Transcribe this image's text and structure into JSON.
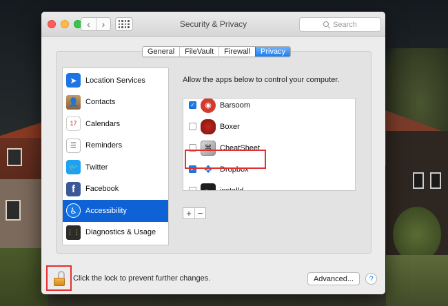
{
  "window": {
    "title": "Security & Privacy",
    "back": "‹",
    "forward": "›",
    "search_placeholder": "Search"
  },
  "tabs": [
    {
      "label": "General",
      "active": false
    },
    {
      "label": "FileVault",
      "active": false
    },
    {
      "label": "Firewall",
      "active": false
    },
    {
      "label": "Privacy",
      "active": true
    }
  ],
  "sidebar": {
    "items": [
      {
        "label": "Location Services",
        "icon": "location-arrow-icon",
        "glyph": "➤",
        "selected": false
      },
      {
        "label": "Contacts",
        "icon": "contacts-book-icon",
        "glyph": "👤",
        "selected": false
      },
      {
        "label": "Calendars",
        "icon": "calendar-icon",
        "glyph": "17",
        "selected": false
      },
      {
        "label": "Reminders",
        "icon": "reminders-list-icon",
        "glyph": "☰",
        "selected": false
      },
      {
        "label": "Twitter",
        "icon": "twitter-bird-icon",
        "glyph": "🐦",
        "selected": false
      },
      {
        "label": "Facebook",
        "icon": "facebook-f-icon",
        "glyph": "f",
        "selected": false
      },
      {
        "label": "Accessibility",
        "icon": "accessibility-person-icon",
        "glyph": "♿",
        "selected": true
      },
      {
        "label": "Diagnostics & Usage",
        "icon": "diagnostics-console-icon",
        "glyph": "⋮⋮",
        "selected": false
      }
    ]
  },
  "panel": {
    "title": "Allow the apps below to control your computer.",
    "apps": [
      {
        "name": "Barsoom",
        "checked": true,
        "icon": "barsoom-app-icon",
        "glyph": "◉"
      },
      {
        "name": "Boxer",
        "checked": false,
        "icon": "boxer-glove-icon",
        "glyph": ""
      },
      {
        "name": "CheatSheet",
        "checked": false,
        "icon": "cheatsheet-app-icon",
        "glyph": "⌘"
      },
      {
        "name": "Dropbox",
        "checked": true,
        "icon": "dropbox-icon",
        "glyph": "❖"
      },
      {
        "name": "installd",
        "checked": false,
        "icon": "installd-terminal-icon",
        "glyph": ">_"
      }
    ],
    "add_label": "+",
    "remove_label": "−"
  },
  "bottom": {
    "lock_text": "Click the lock to prevent further changes.",
    "advanced_label": "Advanced...",
    "help_label": "?"
  },
  "colors": {
    "accent": "#1a7be8",
    "selection": "#0f62d6",
    "highlight": "#e23030"
  }
}
